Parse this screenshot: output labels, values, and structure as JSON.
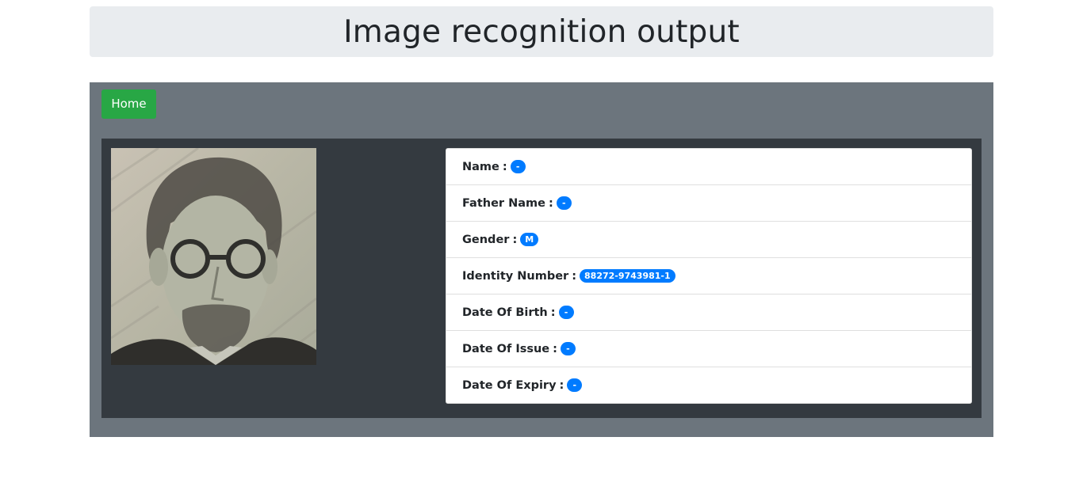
{
  "page": {
    "title": "Image recognition output"
  },
  "nav": {
    "home_label": "Home"
  },
  "details": [
    {
      "label": "Name",
      "separator": ":",
      "value": "-"
    },
    {
      "label": "Father Name",
      "separator": ":",
      "value": "-"
    },
    {
      "label": "Gender",
      "separator": ":",
      "value": "M"
    },
    {
      "label": "Identity Number",
      "separator": ":",
      "value": "88272-9743981-1"
    },
    {
      "label": "Date Of Birth",
      "separator": ":",
      "value": "-"
    },
    {
      "label": "Date Of Issue",
      "separator": ":",
      "value": "-"
    },
    {
      "label": "Date Of Expiry",
      "separator": ":",
      "value": "-"
    }
  ],
  "colors": {
    "header_bg": "#e9ecef",
    "panel_bg": "#6c757d",
    "dark_bg": "#343a40",
    "home_button": "#28a745",
    "badge": "#007bff"
  }
}
